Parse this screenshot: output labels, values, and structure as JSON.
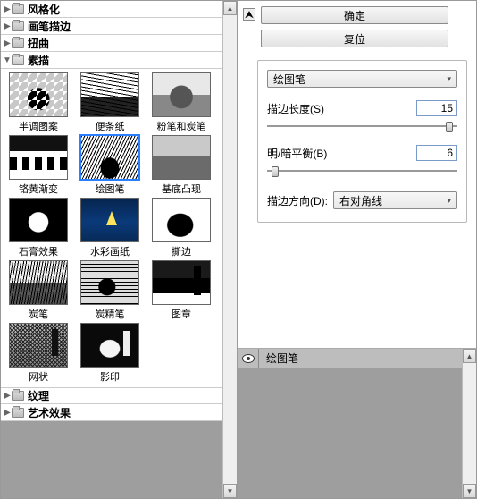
{
  "folders": {
    "stylize": "风格化",
    "brush_strokes": "画笔描边",
    "distort": "扭曲",
    "sketch": "素描",
    "texture": "纹理",
    "artistic": "艺术效果"
  },
  "thumbs": [
    {
      "label": "半调图案"
    },
    {
      "label": "便条纸"
    },
    {
      "label": "粉笔和炭笔"
    },
    {
      "label": "铬黄渐变"
    },
    {
      "label": "绘图笔"
    },
    {
      "label": "基底凸现"
    },
    {
      "label": "石膏效果"
    },
    {
      "label": "水彩画纸"
    },
    {
      "label": "撕边"
    },
    {
      "label": "炭笔"
    },
    {
      "label": "炭精笔"
    },
    {
      "label": "图章"
    },
    {
      "label": "网状"
    },
    {
      "label": "影印"
    }
  ],
  "buttons": {
    "ok": "确定",
    "reset": "复位"
  },
  "filter_group": {
    "selected_filter": "绘图笔",
    "stroke_length": {
      "label": "描边长度(S)",
      "value": "15",
      "pos_pct": 96
    },
    "light_dark": {
      "label": "明/暗平衡(B)",
      "value": "6",
      "pos_pct": 4
    },
    "direction": {
      "label": "描边方向(D):",
      "value": "右对角线"
    }
  },
  "layer": {
    "name": "绘图笔"
  }
}
